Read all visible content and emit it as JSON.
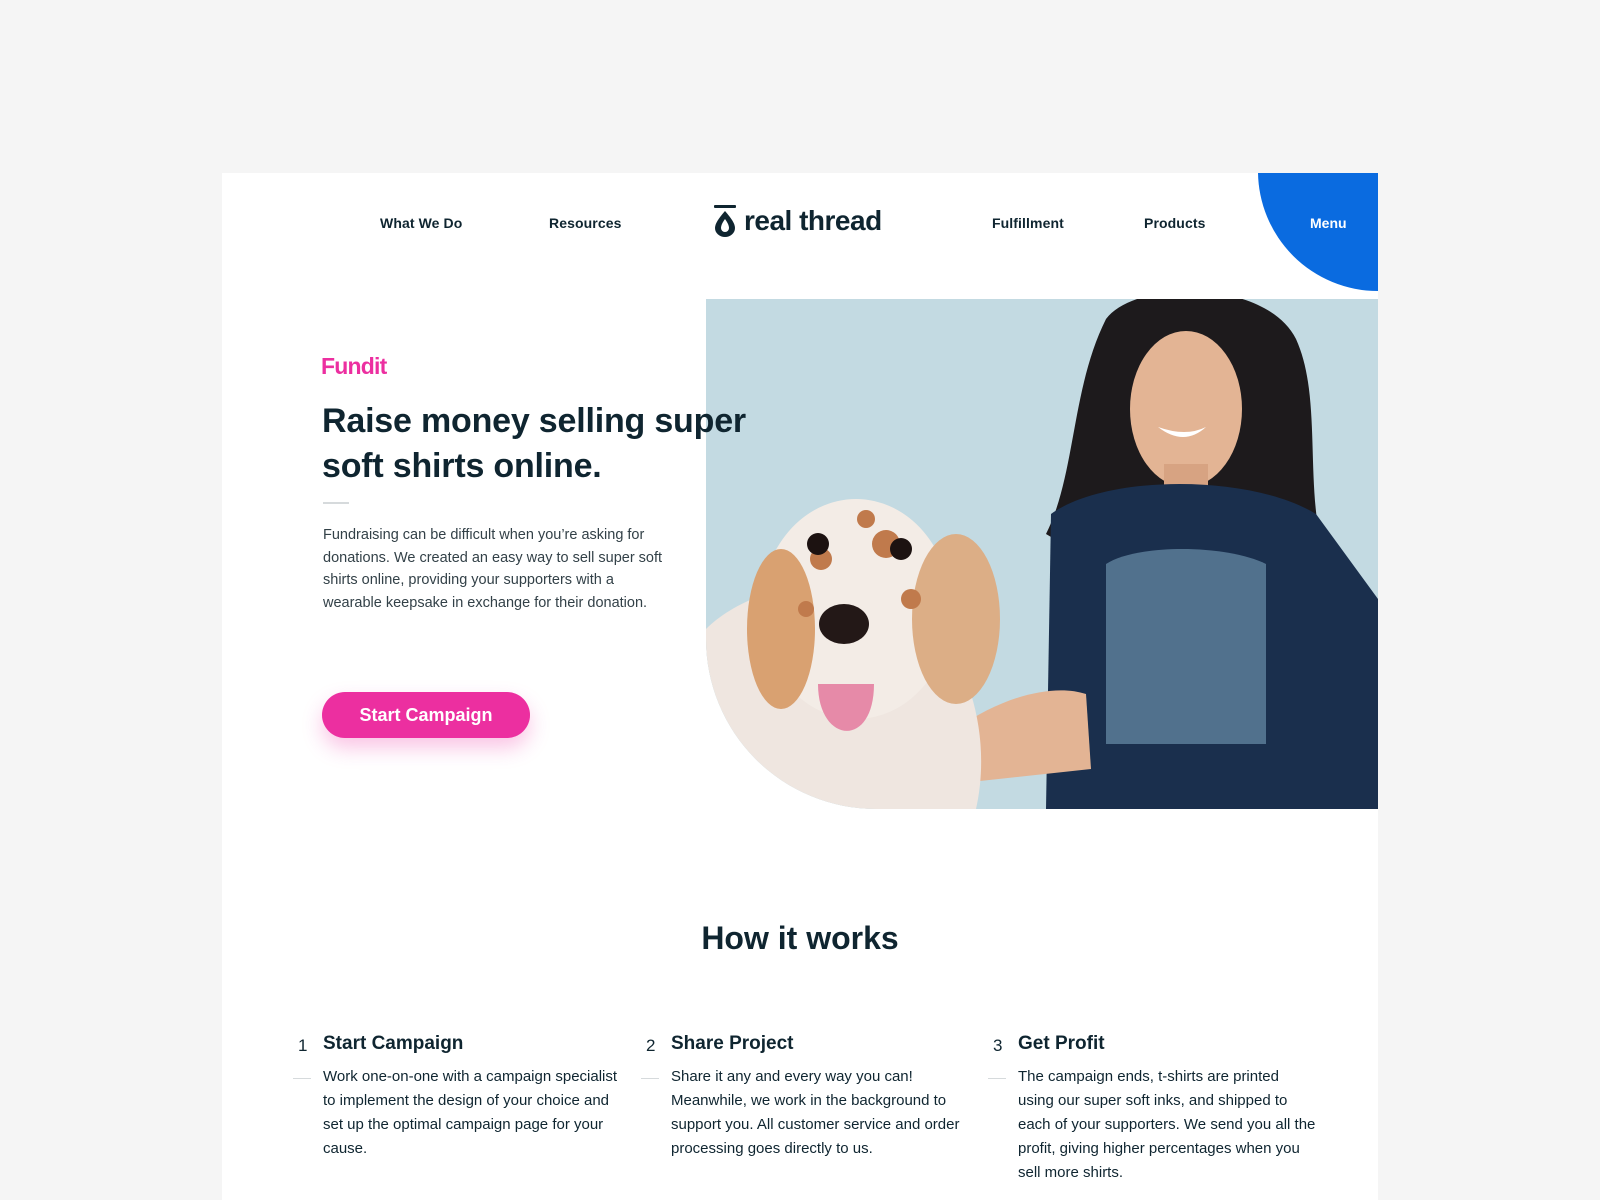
{
  "header": {
    "nav_left": [
      "What We Do",
      "Resources"
    ],
    "nav_right": [
      "Fulfillment",
      "Products"
    ],
    "logo_text": "real thread",
    "menu_label": "Menu",
    "menu_color": "#0a6be0"
  },
  "hero": {
    "brand": "Fundit",
    "headline_line1": "Raise money selling super",
    "headline_line2": "soft shirts online.",
    "intro": "Fundraising can be difficult when you’re asking for donations. We created an easy way to sell super soft shirts online, providing your supporters with a wearable keepsake in exchange for their donation.",
    "cta_label": "Start Campaign",
    "accent_color": "#ec2fa0"
  },
  "how": {
    "title": "How it works",
    "steps": [
      {
        "number": "1",
        "title": "Start Campaign",
        "text": "Work one-on-one with a campaign specialist to implement the design of your choice and set up the optimal campaign page for your cause."
      },
      {
        "number": "2",
        "title": "Share Project",
        "text": "Share it any and every way you can! Meanwhile, we work in the background to support you. All customer service and order processing goes directly to us."
      },
      {
        "number": "3",
        "title": "Get Profit",
        "text": "The campaign ends, t-shirts are printed using our super soft inks, and shipped to each of your supporters. We send you all the profit, giving higher percentages when you sell more shirts."
      }
    ]
  }
}
